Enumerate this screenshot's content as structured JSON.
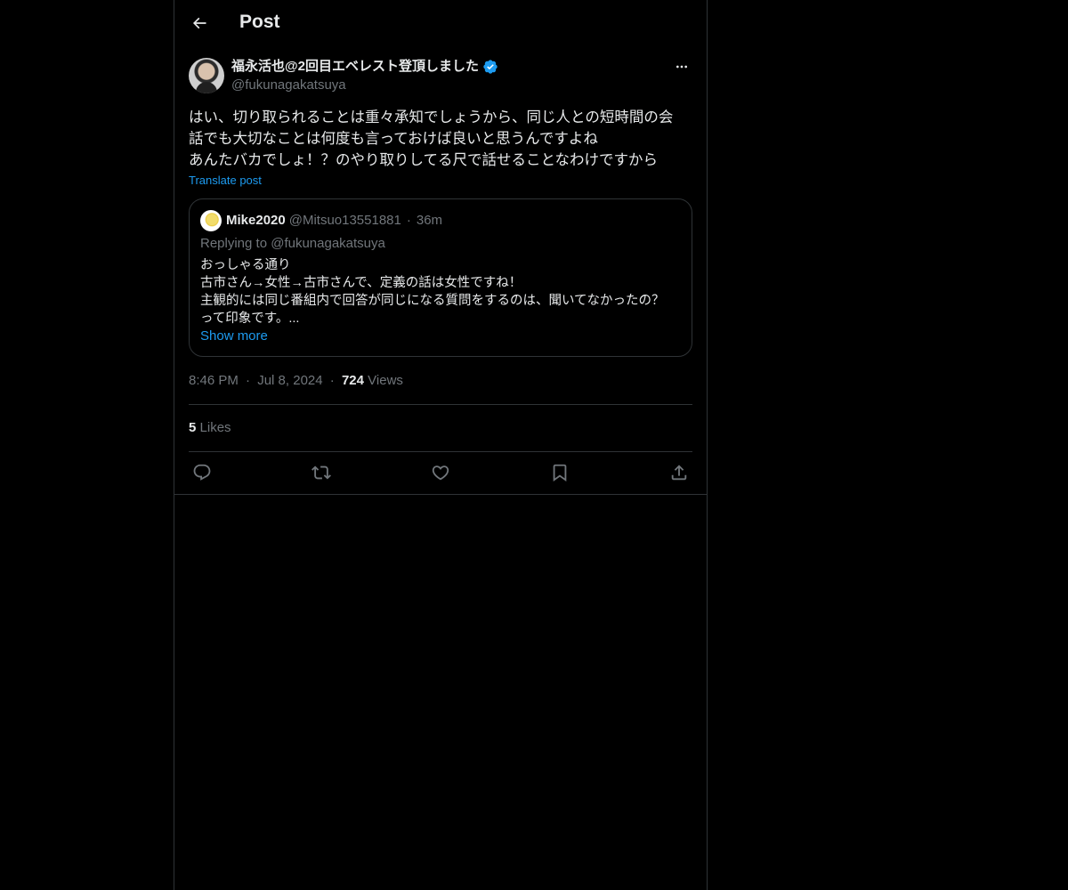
{
  "header": {
    "title": "Post",
    "back_icon": "arrow-left-icon"
  },
  "post": {
    "author": {
      "display_name": "福永活也@2回目エベレスト登頂しました",
      "handle": "@fukunagakatsuya",
      "verified": true,
      "verified_color": "#1d9bf0"
    },
    "text_lines": [
      "はい、切り取られることは重々承知でしょうから、同じ人との短時間の会",
      "話でも大切なことは何度も言っておけば良いと思うんですよね",
      "あんたバカでしょ！？のやり取りしてる尺で話せることなわけですから"
    ],
    "translate_label": "Translate post",
    "quote": {
      "name": "Mike2020",
      "handle": "@Mitsuo13551881",
      "separator": "·",
      "time": "36m",
      "replying_label": "Replying to",
      "replying_handle": "@fukunagakatsuya",
      "text_lines": [
        "おっしゃる通り",
        "古市さん→女性→古市さんで、定義の話は女性ですね！",
        "主観的には同じ番組内で回答が同じになる質問をするのは、聞いてなかったの？",
        "って印象です。..."
      ],
      "show_more_label": "Show more"
    },
    "meta": {
      "time": "8:46 PM",
      "separator": "·",
      "date": "Jul 8, 2024",
      "views_count": "724",
      "views_label": "Views"
    },
    "likes": {
      "count": "5",
      "label": "Likes"
    },
    "actions": [
      "reply-icon",
      "repost-icon",
      "like-icon",
      "bookmark-icon",
      "share-icon"
    ]
  },
  "colors": {
    "background": "#000000",
    "text": "#e7e9ea",
    "muted": "#71767b",
    "accent": "#1d9bf0",
    "border": "#2f3336"
  }
}
